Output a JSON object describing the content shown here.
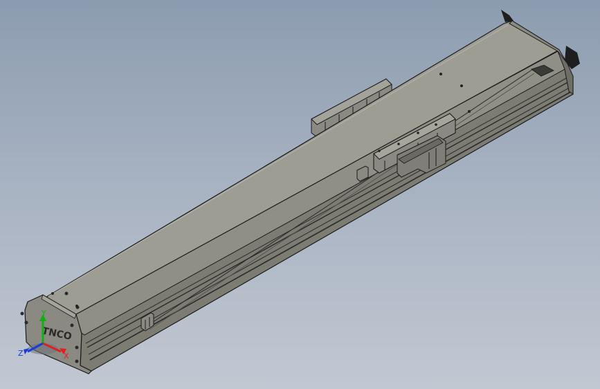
{
  "viewport": {
    "background_top": "#8c9cb0",
    "background_bottom": "#c2c8d2"
  },
  "model": {
    "part": "linear-actuator-module",
    "body_color": "#8f8f86",
    "top_face_color": "#9d9d94",
    "side_face_color": "#7c7c73",
    "edge_color": "#1a1a1a",
    "end_plate_logo": "TNCO"
  },
  "triad": {
    "x_label": "X",
    "y_label": "Y",
    "z_label": "Z",
    "x_color": "#e02020",
    "y_color": "#10b010",
    "z_color": "#1a3cd6"
  }
}
